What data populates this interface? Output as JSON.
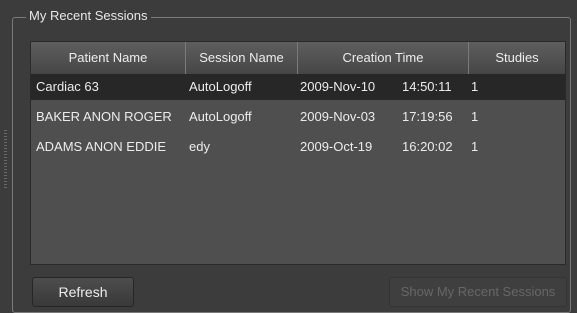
{
  "group": {
    "title": "My Recent Sessions"
  },
  "table": {
    "columns": [
      "Patient Name",
      "Session Name",
      "Creation Time",
      "Studies"
    ],
    "rows": [
      {
        "patient": "Cardiac 63",
        "session": "AutoLogoff",
        "date": "2009-Nov-10",
        "time": "14:50:11",
        "studies": "1",
        "selected": true
      },
      {
        "patient": "BAKER ANON ROGER",
        "session": "AutoLogoff",
        "date": "2009-Nov-03",
        "time": "17:19:56",
        "studies": "1",
        "selected": false
      },
      {
        "patient": "ADAMS ANON EDDIE",
        "session": "edy",
        "date": "2009-Oct-19",
        "time": "16:20:02",
        "studies": "1",
        "selected": false
      }
    ]
  },
  "buttons": {
    "refresh": "Refresh",
    "show_recent": "Show My Recent Sessions"
  }
}
